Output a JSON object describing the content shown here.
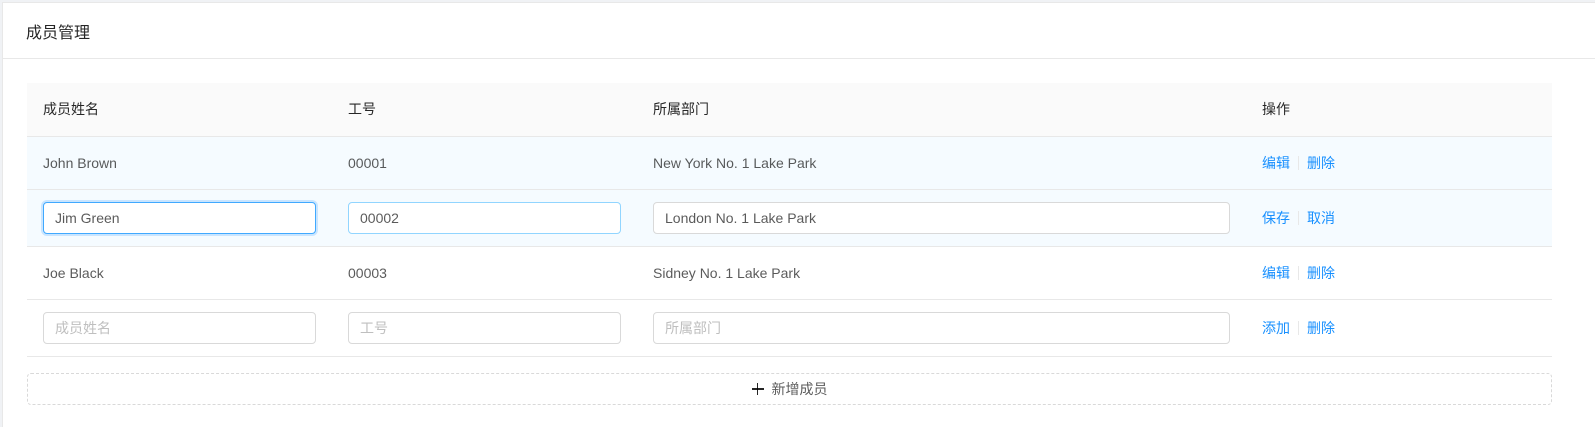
{
  "card": {
    "title": "成员管理"
  },
  "table": {
    "columns": [
      "成员姓名",
      "工号",
      "所属部门",
      "操作"
    ],
    "rows": [
      {
        "mode": "view",
        "name": "John Brown",
        "id": "00001",
        "department": "New York No. 1 Lake Park",
        "actions": [
          "编辑",
          "删除"
        ]
      },
      {
        "mode": "edit",
        "name": "Jim Green",
        "id": "00002",
        "department": "London No. 1 Lake Park",
        "actions": [
          "保存",
          "取消"
        ]
      },
      {
        "mode": "view",
        "name": "Joe Black",
        "id": "00003",
        "department": "Sidney No. 1 Lake Park",
        "actions": [
          "编辑",
          "删除"
        ]
      },
      {
        "mode": "new",
        "name": "",
        "id": "",
        "department": "",
        "placeholders": {
          "name": "成员姓名",
          "id": "工号",
          "department": "所属部门"
        },
        "actions": [
          "添加",
          "删除"
        ]
      }
    ]
  },
  "add_button": {
    "label": "新增成员",
    "icon": "plus-icon"
  },
  "colors": {
    "primary": "#1890ff",
    "focus_border": "#40a9ff",
    "row_highlight": "#f5fbff",
    "header_bg": "#fafafa",
    "border": "#e8e8e8"
  }
}
